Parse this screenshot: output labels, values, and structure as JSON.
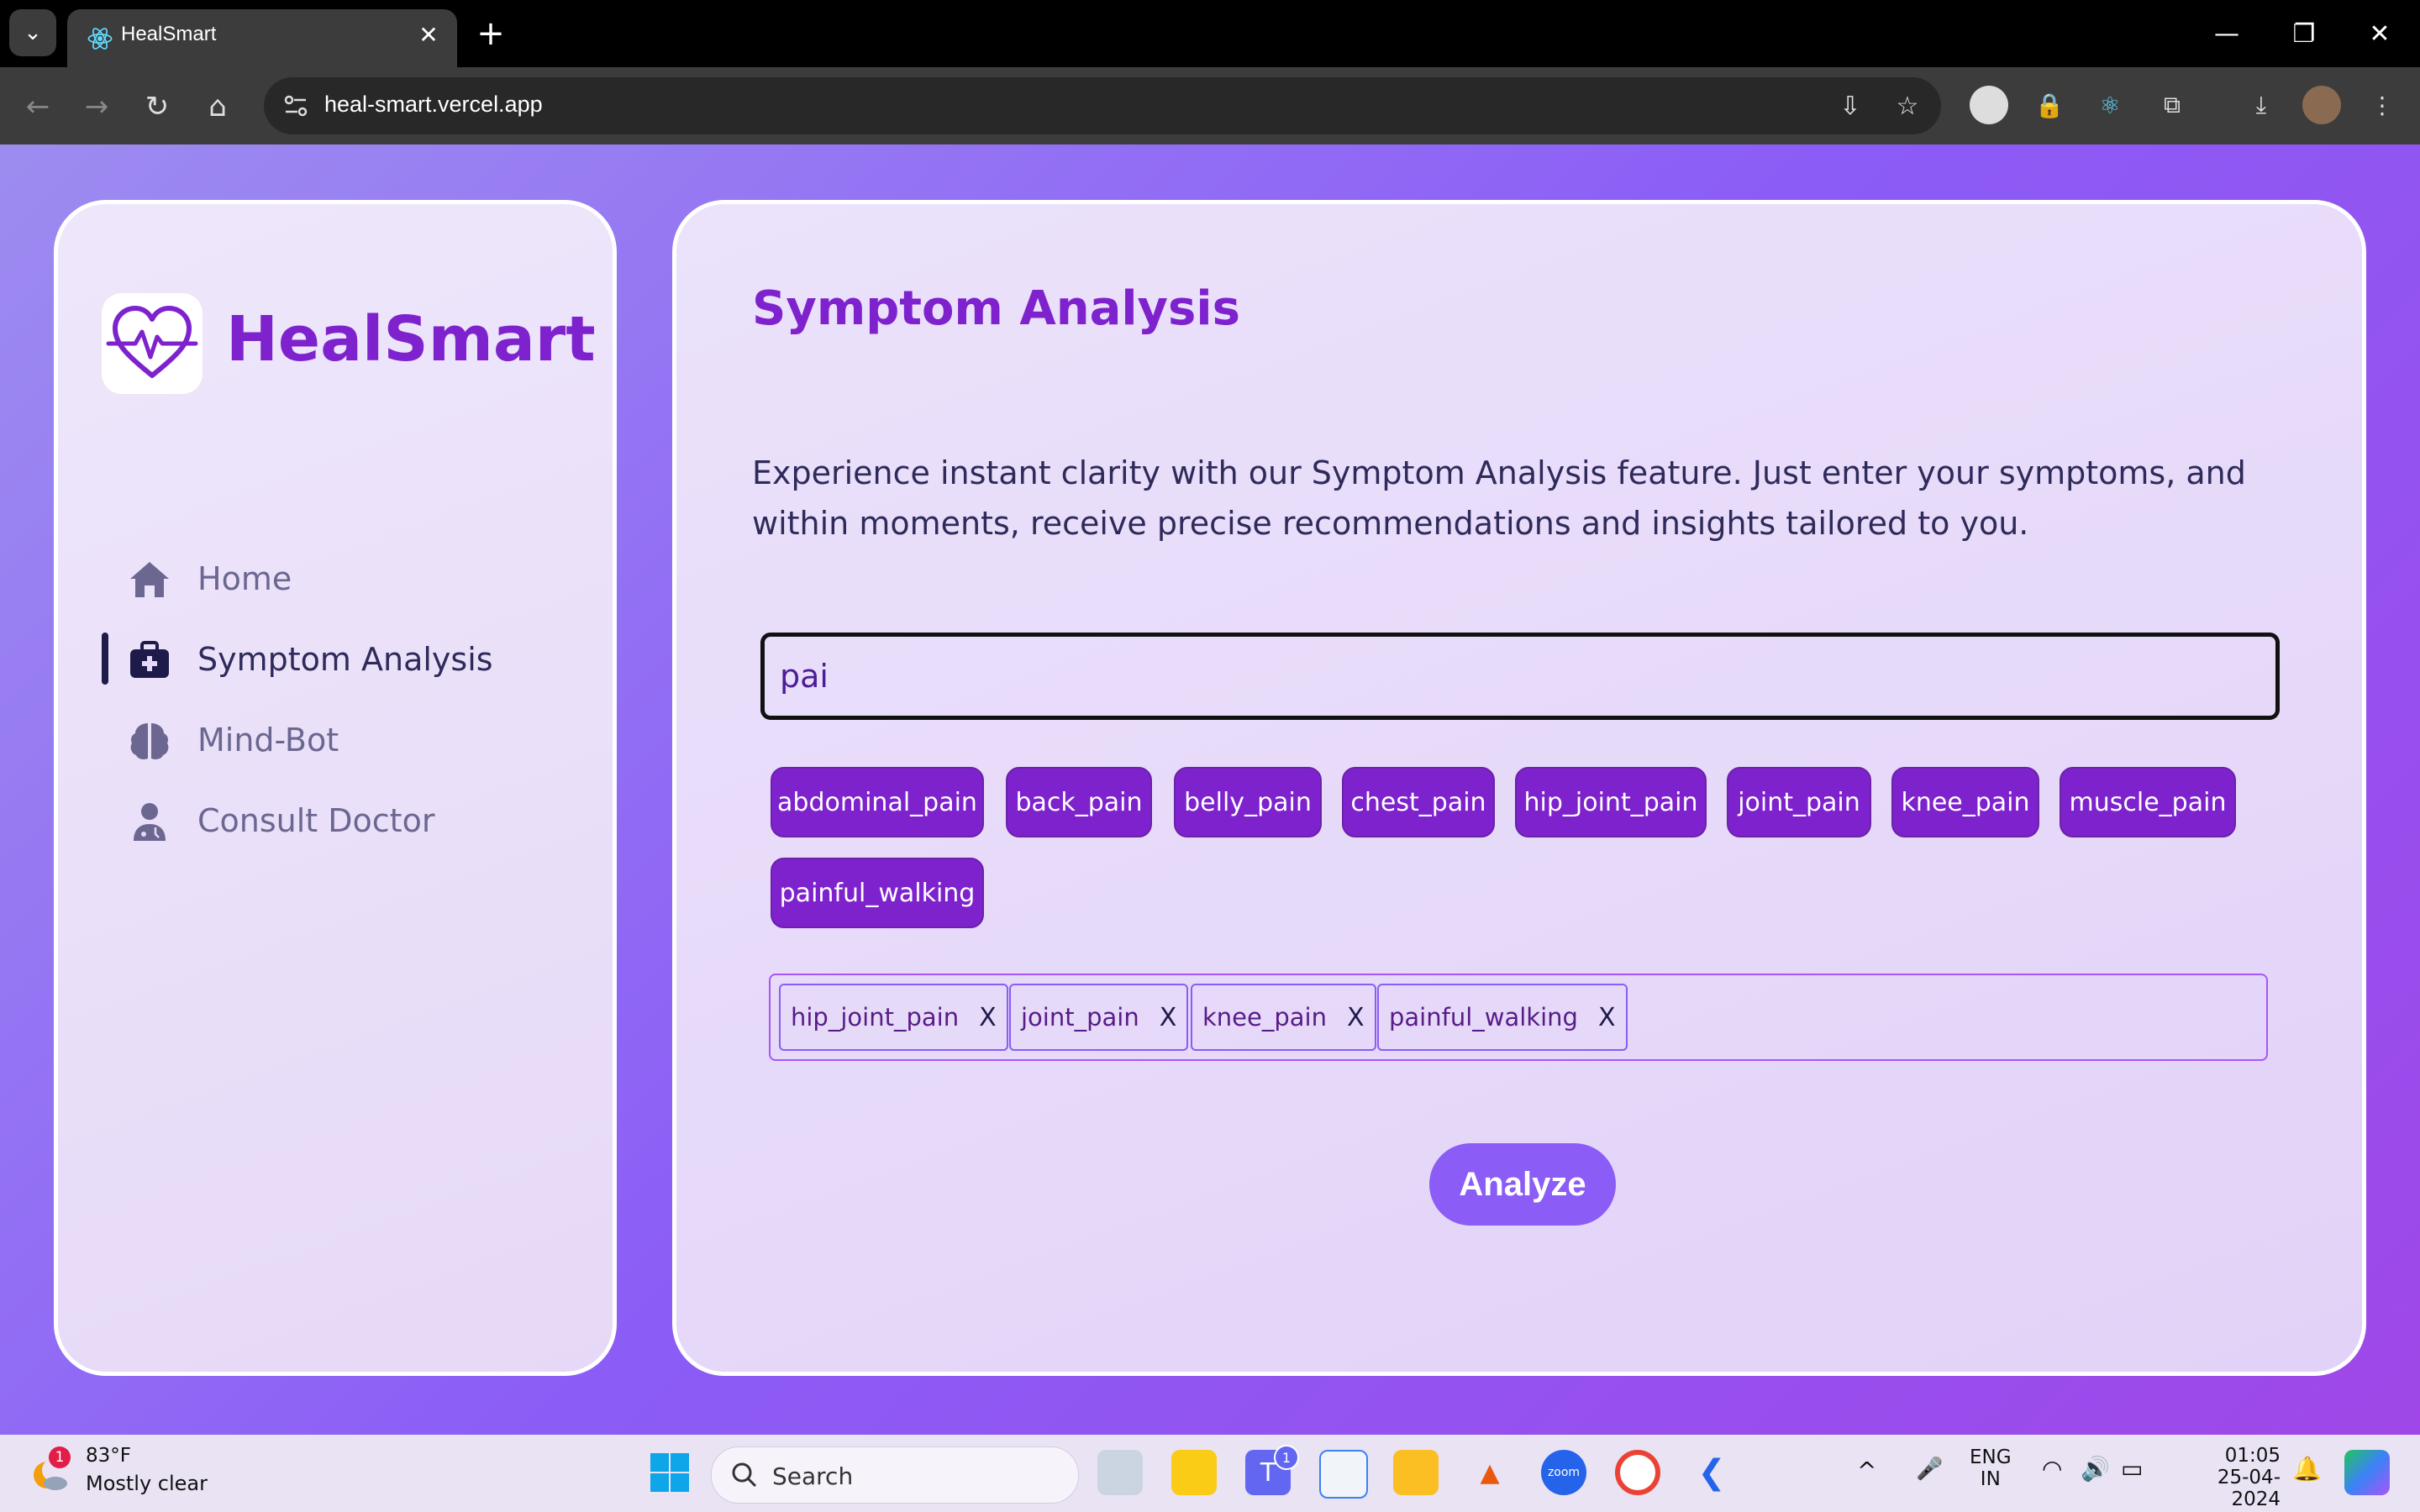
{
  "browser": {
    "tab_title": "HealSmart",
    "url": "heal-smart.vercel.app"
  },
  "sidebar": {
    "brand": "HealSmart",
    "items": [
      {
        "label": "Home",
        "icon": "home-icon",
        "active": false
      },
      {
        "label": "Symptom Analysis",
        "icon": "medical-kit-icon",
        "active": true
      },
      {
        "label": "Mind-Bot",
        "icon": "brain-icon",
        "active": false
      },
      {
        "label": "Consult Doctor",
        "icon": "doctor-icon",
        "active": false
      }
    ]
  },
  "main": {
    "title": "Symptom Analysis",
    "description": "Experience instant clarity with our Symptom Analysis feature. Just enter your symptoms, and within moments, receive precise recommendations and insights tailored to you.",
    "search_value": "pai",
    "suggestions": [
      "abdominal_pain",
      "back_pain",
      "belly_pain",
      "chest_pain",
      "hip_joint_pain",
      "joint_pain",
      "knee_pain",
      "muscle_pain",
      "painful_walking"
    ],
    "selected": [
      "hip_joint_pain",
      "joint_pain",
      "knee_pain",
      "painful_walking"
    ],
    "remove_label": "X",
    "analyze_label": "Analyze"
  },
  "taskbar": {
    "weather_badge": "1",
    "weather_temp": "83°F",
    "weather_condition": "Mostly clear",
    "search_label": "Search",
    "teams_badge": "1",
    "lang_line1": "ENG",
    "lang_line2": "IN",
    "time": "01:05",
    "date": "25-04-2024"
  },
  "colors": {
    "brand": "#7e22ce",
    "accent": "#8b5cf6",
    "text_dark": "#2e2a5a"
  }
}
